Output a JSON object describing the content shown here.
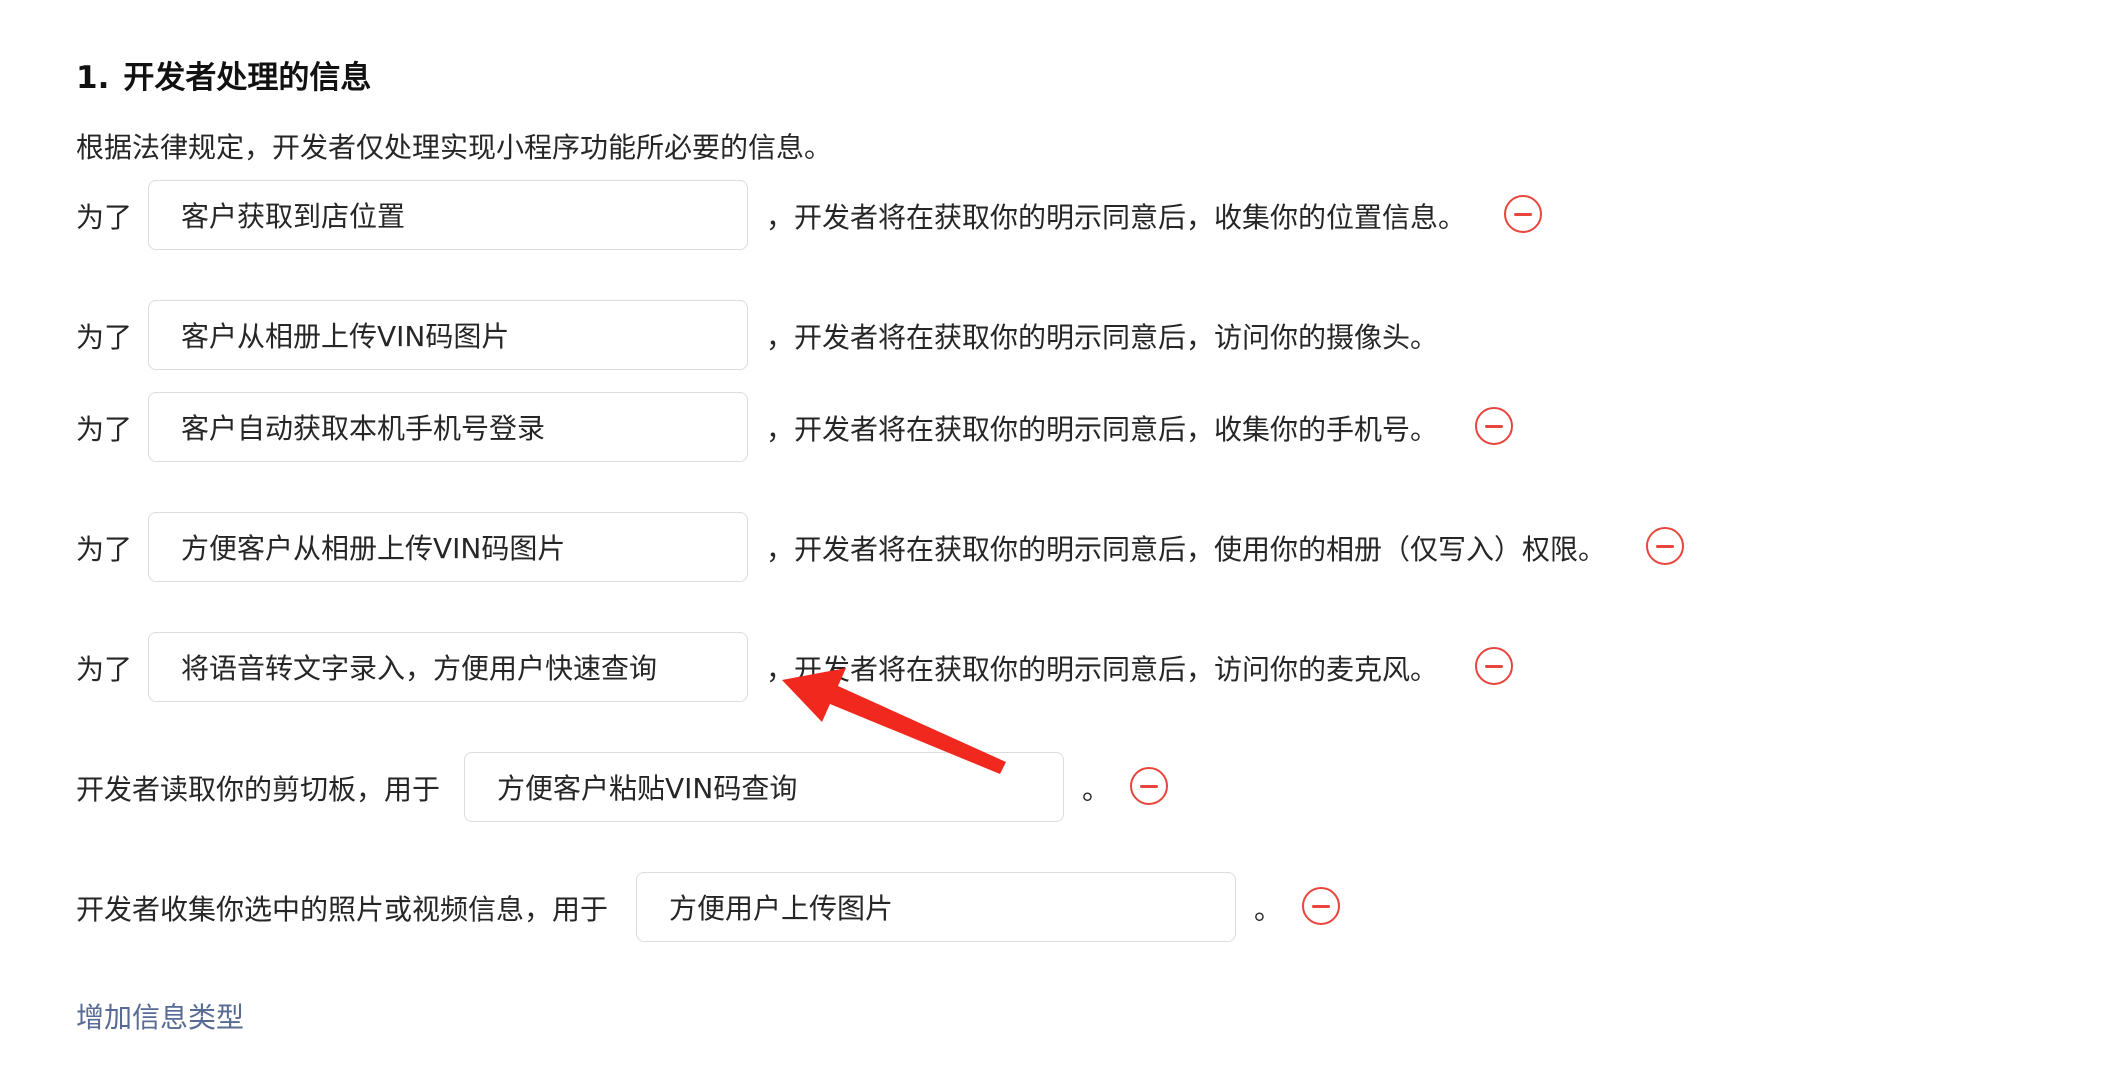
{
  "section": {
    "number": "1.",
    "title": "开发者处理的信息",
    "intro": "根据法律规定，开发者仅处理实现小程序功能所必要的信息。"
  },
  "rows": [
    {
      "prefix": "为了",
      "value": "客户获取到店位置",
      "suffix": "，开发者将在获取你的明示同意后，收集你的位置信息。"
    },
    {
      "prefix": "为了",
      "value": "客户从相册上传VIN码图片",
      "suffix": "，开发者将在获取你的明示同意后，访问你的摄像头。"
    },
    {
      "prefix": "为了",
      "value": "客户自动获取本机手机号登录",
      "suffix": "，开发者将在获取你的明示同意后，收集你的手机号。"
    },
    {
      "prefix": "为了",
      "value": "方便客户从相册上传VIN码图片",
      "suffix": "，开发者将在获取你的明示同意后，使用你的相册（仅写入）权限。"
    },
    {
      "prefix": "为了",
      "value": "将语音转文字录入，方便用户快速查询",
      "suffix": "，开发者将在获取你的明示同意后，访问你的麦克风。"
    },
    {
      "prefix": "开发者读取你的剪切板，用于",
      "value": "方便客户粘贴VIN码查询",
      "suffix": "。"
    },
    {
      "prefix": "开发者收集你选中的照片或视频信息，用于",
      "value": "方便用户上传图片",
      "suffix": "。"
    }
  ],
  "add_link": "增加信息类型",
  "colors": {
    "remove": "#e8453c",
    "link": "#576b95",
    "annotation_arrow": "#f0281e",
    "border": "#dcdcdc"
  },
  "icons": {
    "remove": "minus-circle-icon",
    "annotation": "arrow-annotation"
  }
}
